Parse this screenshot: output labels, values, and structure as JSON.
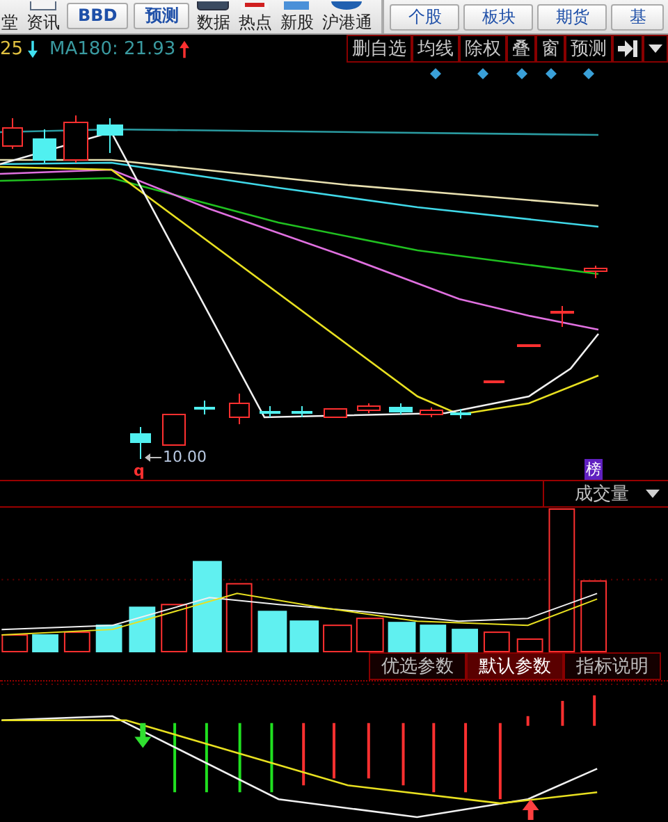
{
  "toolbar": {
    "left_items": [
      {
        "label": "堂",
        "kind": "plain"
      },
      {
        "label": "资讯",
        "kind": "doc"
      },
      {
        "label": "BBD",
        "kind": "button"
      },
      {
        "label": "预测",
        "kind": "button"
      },
      {
        "label": "数据",
        "kind": "monitor"
      },
      {
        "label": "热点",
        "kind": "hot"
      },
      {
        "label": "新股",
        "kind": "square"
      },
      {
        "label": "沪港通",
        "kind": "globe"
      }
    ],
    "right_tabs": [
      {
        "label": "个股"
      },
      {
        "label": "板块"
      },
      {
        "label": "期货"
      },
      {
        "label": "基"
      }
    ]
  },
  "info_bar": {
    "value": "25",
    "ma_label": "MA180: 21.93"
  },
  "chart_buttons": [
    {
      "label": "删自选",
      "marked": false
    },
    {
      "label": "均线",
      "marked": true
    },
    {
      "label": "除权",
      "marked": true
    },
    {
      "label": "叠",
      "marked": true
    },
    {
      "label": "窗",
      "marked": true
    },
    {
      "label": "预测",
      "marked": true
    }
  ],
  "price_label": "10.00",
  "low_marker": "q",
  "badge": "榜",
  "volume_selector": {
    "label": "成交量"
  },
  "param_tabs": [
    {
      "label": "优选参数",
      "selected": false
    },
    {
      "label": "默认参数",
      "selected": true
    },
    {
      "label": "指标说明",
      "selected": false
    }
  ]
}
